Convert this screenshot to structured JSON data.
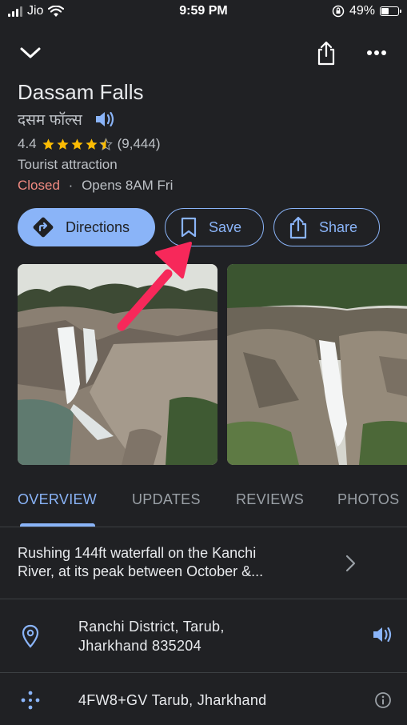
{
  "status_bar": {
    "carrier": "Jio",
    "time": "9:59 PM",
    "battery": "49%",
    "battery_level": 0.49
  },
  "top_bar": {
    "collapse_icon": "chevron-down-icon",
    "share_icon": "share-icon",
    "more_icon": "more-options-icon"
  },
  "place": {
    "name": "Dassam Falls",
    "local_name": "दसम फॉल्स",
    "rating": "4.4",
    "rating_value": 4.4,
    "reviews_count": "(9,444)",
    "category": "Tourist attraction",
    "status": "Closed",
    "separator": "·",
    "opens": "Opens 8AM Fri"
  },
  "actions": {
    "directions": "Directions",
    "save": "Save",
    "share": "Share"
  },
  "tabs": [
    "OVERVIEW",
    "UPDATES",
    "REVIEWS",
    "PHOTOS"
  ],
  "overview": {
    "description_line1": "Rushing 144ft waterfall on the Kanchi",
    "description_line2": "River, at its peak between October &..."
  },
  "address": {
    "line1": "Ranchi District, Tarub,",
    "line2": "Jharkhand 835204"
  },
  "plus_code": "4FW8+GV Tarub, Jharkhand",
  "colors": {
    "background": "#202124",
    "accent": "#8ab4f8",
    "closed": "#f28b82",
    "star": "#fbbc04",
    "annotation_arrow": "#f7285a"
  }
}
